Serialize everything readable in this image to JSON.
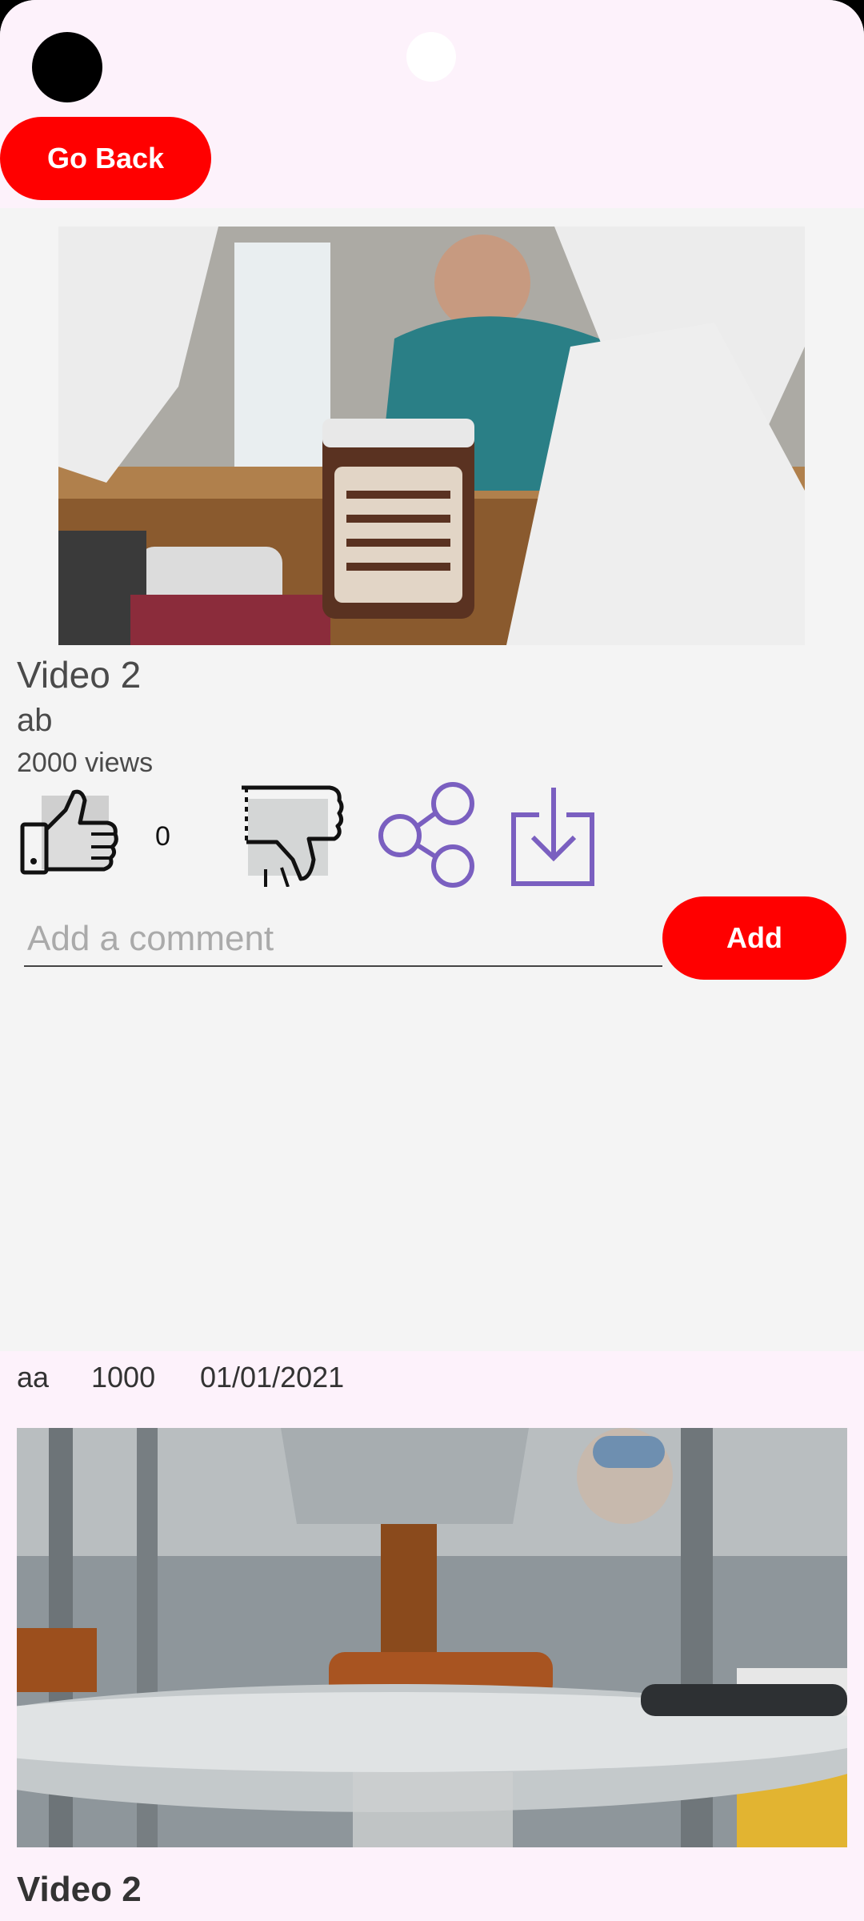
{
  "header": {
    "go_back_label": "Go Back"
  },
  "video": {
    "title": "Video 2",
    "author": "ab",
    "views": "2000 views",
    "likes": "0"
  },
  "comment": {
    "placeholder": "Add a comment",
    "add_label": "Add"
  },
  "list_item": {
    "author": "aa",
    "views": "1000",
    "date": "01/01/2021",
    "title": "Video 2"
  },
  "icons": {
    "like": "thumbs-up-icon",
    "dislike": "thumbs-down-icon",
    "share": "share-icon",
    "download": "download-icon"
  },
  "colors": {
    "accent": "#ff0000",
    "icon_purple": "#7a5fc0",
    "top_bg": "#fdf2fb",
    "content_bg": "#f4f4f4"
  }
}
